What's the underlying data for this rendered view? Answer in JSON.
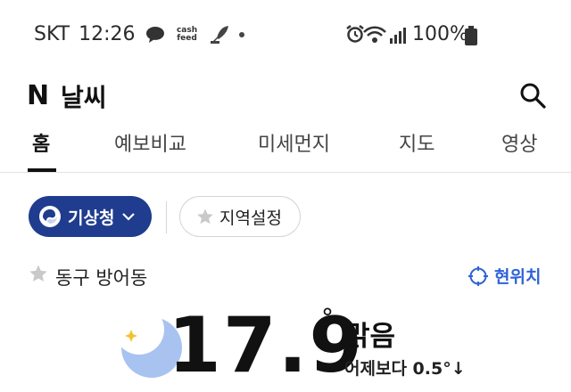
{
  "status_bar": {
    "carrier": "SKT",
    "time": "12:26",
    "cashfeed_label": "cash feed",
    "battery_text": "100%"
  },
  "header": {
    "logo": "N",
    "title": "날씨",
    "search_icon": "search-icon"
  },
  "tabs": [
    {
      "label": "홈",
      "active": true
    },
    {
      "label": "예보비교",
      "active": false
    },
    {
      "label": "미세먼지",
      "active": false
    },
    {
      "label": "지도",
      "active": false
    },
    {
      "label": "영상",
      "active": false
    }
  ],
  "chips": {
    "source_label": "기상청",
    "region_label": "지역설정"
  },
  "location": {
    "name": "동구 방어동",
    "current_location_label": "현위치"
  },
  "weather": {
    "temperature": "17.9",
    "degree_symbol": "°",
    "condition": "맑음",
    "comparison": "어제보다 0.5°↓"
  },
  "colors": {
    "primary_chip": "#1f3c8f",
    "accent_blue": "#2f63d6",
    "moon": "#a8c3f0"
  }
}
